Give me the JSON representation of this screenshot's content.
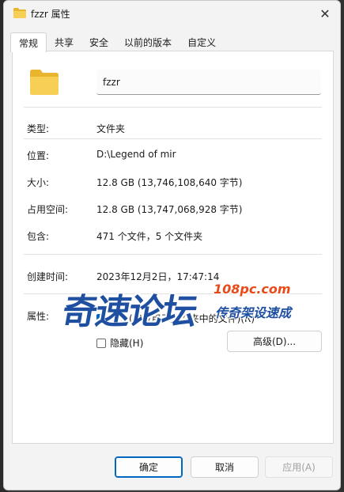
{
  "window": {
    "title": "fzzr 属性",
    "close_glyph": "✕"
  },
  "tabs": [
    {
      "label": "常规",
      "active": true
    },
    {
      "label": "共享",
      "active": false
    },
    {
      "label": "安全",
      "active": false
    },
    {
      "label": "以前的版本",
      "active": false
    },
    {
      "label": "自定义",
      "active": false
    }
  ],
  "general": {
    "folder_name": "fzzr",
    "type_label": "类型:",
    "type_value": "文件夹",
    "location_label": "位置:",
    "location_value": "D:\\Legend of mir",
    "size_label": "大小:",
    "size_value": "12.8 GB (13,746,108,640 字节)",
    "size_on_disk_label": "占用空间:",
    "size_on_disk_value": "12.8 GB (13,747,068,928 字节)",
    "contains_label": "包含:",
    "contains_value": "471 个文件，5 个文件夹",
    "created_label": "创建时间:",
    "created_value": "2023年12月2日，17:47:14",
    "attributes_label": "属性:",
    "readonly_label": "只读(仅应用于文件夹中的文件)(R)",
    "readonly_state": "indeterminate",
    "hidden_label": "隐藏(H)",
    "hidden_checked": false,
    "advanced_button": "高级(D)..."
  },
  "footer": {
    "ok_label": "确定",
    "cancel_label": "取消",
    "apply_label": "应用(A)"
  },
  "watermark": {
    "main_text": "奇速论坛",
    "url": "108pc.com",
    "sub_text": "传奇架设速成"
  },
  "colors": {
    "accent": "#0067c0",
    "folder_yellow": "#f4c542",
    "watermark_blue": "#1e4fa0",
    "watermark_orange": "#e84b1a"
  }
}
